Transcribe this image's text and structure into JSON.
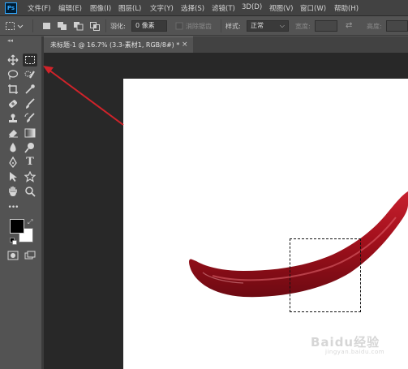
{
  "app": {
    "logo_text": "Ps"
  },
  "menu": {
    "items": [
      "文件(F)",
      "编辑(E)",
      "图像(I)",
      "图层(L)",
      "文字(Y)",
      "选择(S)",
      "滤镜(T)",
      "3D(D)",
      "视图(V)",
      "窗口(W)",
      "帮助(H)"
    ]
  },
  "options_bar": {
    "feather_label": "羽化:",
    "feather_value": "0 像素",
    "antialias_label": "消除锯齿",
    "style_label": "样式:",
    "style_value": "正常",
    "width_label": "宽度:",
    "height_label": "高度:"
  },
  "toolbar": {
    "collapse_glyph": "◂◂",
    "more_glyph": "•••"
  },
  "document": {
    "tab_title": "未标题-1 @ 16.7% (3.3-素材1, RGB/8#) *",
    "tab_close": "×"
  },
  "watermark": {
    "text": "Baidu经验",
    "sub": "jingyan.baidu.com"
  },
  "colors": {
    "ui_bg": "#535353",
    "menubar_bg": "#424242",
    "pasteboard": "#282828",
    "canvas": "#ffffff",
    "arrow": "#d0232a",
    "pepper": "#a3101c",
    "accent": "#31a8ff"
  }
}
